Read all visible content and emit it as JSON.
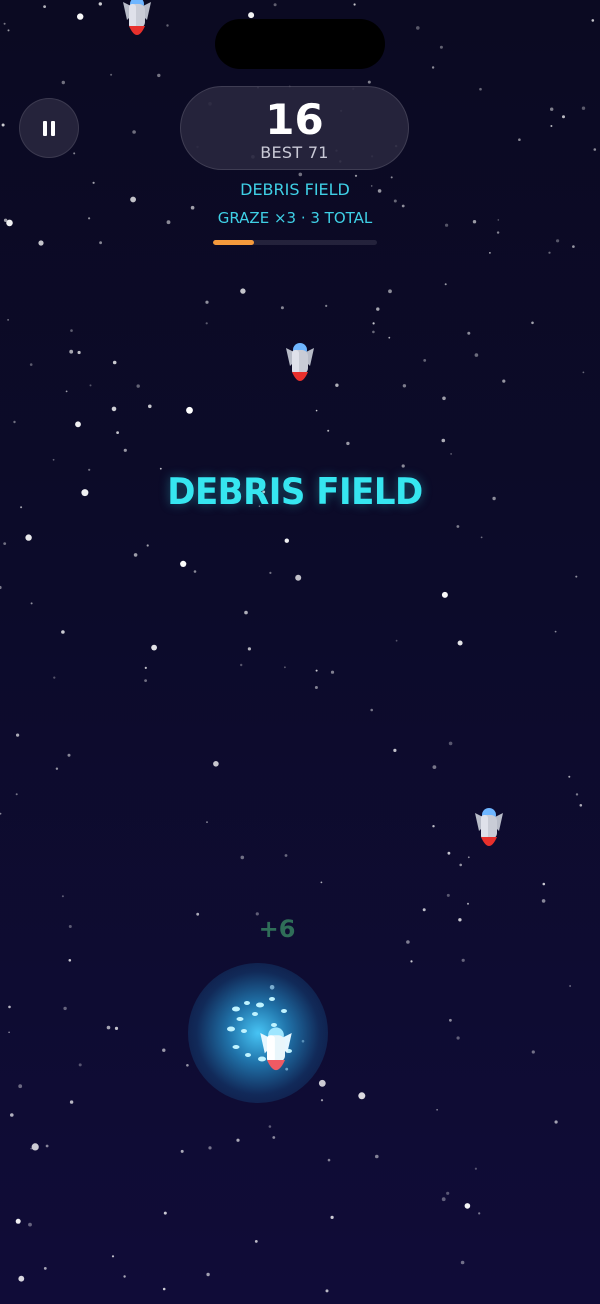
{
  "hud": {
    "score": "16",
    "best_label": "BEST 71",
    "level_name": "DEBRIS FIELD",
    "graze_text": "GRAZE ×3  ·  3 TOTAL",
    "progress": 0.25,
    "pause_icon": "pause-icon"
  },
  "banner": {
    "text": "DEBRIS FIELD"
  },
  "combo_popup": {
    "text": "+6"
  },
  "colors": {
    "accent_cyan": "#3fd0e6",
    "banner_cyan": "#36e6f0",
    "progress_orange": "#f59a3c",
    "combo_green": "#2f6e58",
    "background": "#0c0b2a",
    "shield_glow": "#4aceff"
  },
  "entities": {
    "player_icon": "player-rocket-icon",
    "enemy_icon": "enemy-rocket-icon",
    "enemy_count": 3
  }
}
